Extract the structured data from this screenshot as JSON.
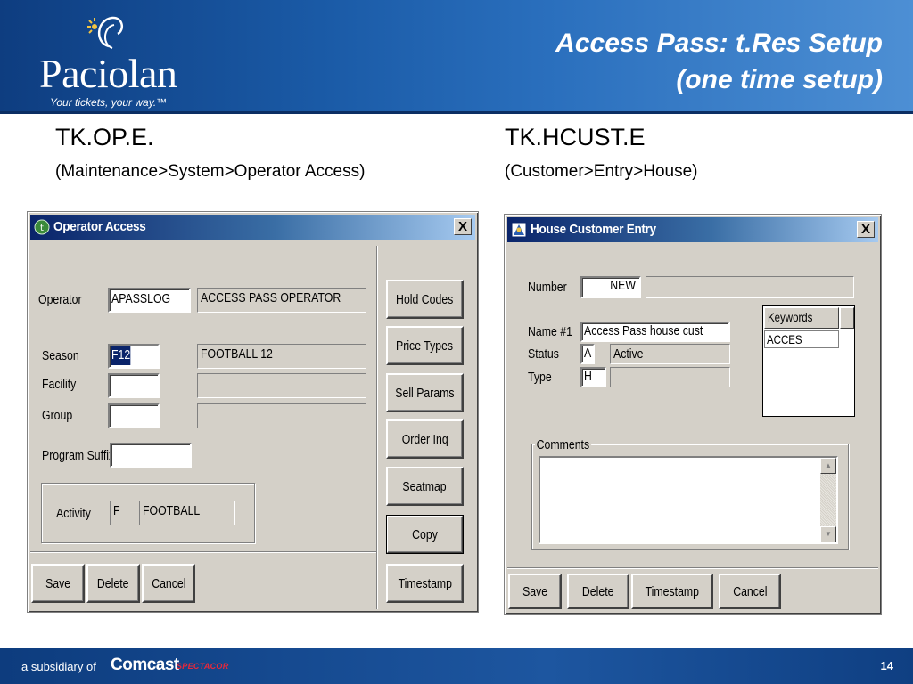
{
  "header": {
    "logo_text": "Paciolan",
    "logo_tagline": "Your tickets, your way.™",
    "title_line1": "Access Pass: t.Res Setup",
    "title_line2": "(one time setup)"
  },
  "left_section": {
    "code": "TK.OP.E.",
    "path": "(Maintenance>System>Operator Access)"
  },
  "right_section": {
    "code": "TK.HCUST.E",
    "path": "(Customer>Entry>House)"
  },
  "operator_dialog": {
    "title": "Operator Access",
    "close_glyph": "X",
    "operator_label": "Operator",
    "operator_value": "APASSLOG",
    "operator_desc": "ACCESS PASS OPERATOR",
    "season_label": "Season",
    "season_value": "F12",
    "season_desc": "FOOTBALL 12",
    "facility_label": "Facility",
    "facility_value": "",
    "facility_desc": "",
    "group_label": "Group",
    "group_value": "",
    "group_desc": "",
    "program_suffix_label": "Program Suffix",
    "program_suffix_value": "",
    "activity_label": "Activity",
    "activity_code": "F",
    "activity_desc": "FOOTBALL",
    "side_buttons": {
      "hold_codes": "Hold Codes",
      "price_types": "Price Types",
      "sell_params": "Sell Params",
      "order_inq": "Order Inq",
      "seatmap": "Seatmap",
      "copy": "Copy",
      "timestamp": "Timestamp"
    },
    "bottom_buttons": {
      "save": "Save",
      "delete": "Delete",
      "cancel": "Cancel"
    }
  },
  "house_dialog": {
    "title": "House Customer Entry",
    "close_glyph": "X",
    "number_label": "Number",
    "number_value": "NEW",
    "number_desc": "",
    "name_label": "Name #1",
    "name_value": "Access Pass house cust",
    "status_label": "Status",
    "status_value": "A",
    "status_desc": "Active",
    "type_label": "Type",
    "type_value": "H",
    "type_desc": "",
    "keywords_header": "Keywords",
    "keywords": [
      "ACCES"
    ],
    "comments_label": "Comments",
    "comments_value": "",
    "buttons": {
      "save": "Save",
      "delete": "Delete",
      "timestamp": "Timestamp",
      "cancel": "Cancel"
    }
  },
  "footer": {
    "subsidiary_text": "a subsidiary of",
    "brand": "Comcast",
    "brand_sub": "SPECTACOR",
    "page_number": "14"
  }
}
